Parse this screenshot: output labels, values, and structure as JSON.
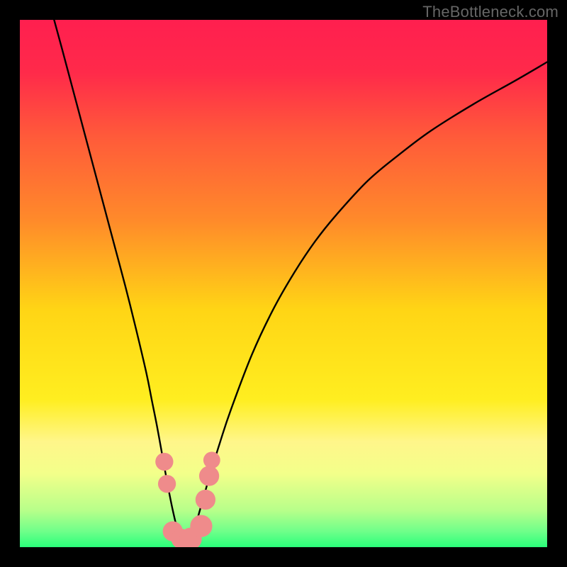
{
  "watermark": "TheBottleneck.com",
  "chart_data": {
    "type": "line",
    "title": "",
    "xlabel": "",
    "ylabel": "",
    "xlim": [
      0,
      100
    ],
    "ylim": [
      0,
      100
    ],
    "grid": false,
    "legend": false,
    "background_gradient": {
      "type": "vertical",
      "stops": [
        {
          "pos": 0.0,
          "color": "#ff1f4f"
        },
        {
          "pos": 0.1,
          "color": "#ff2a4a"
        },
        {
          "pos": 0.22,
          "color": "#ff5a3a"
        },
        {
          "pos": 0.38,
          "color": "#ff8a2a"
        },
        {
          "pos": 0.55,
          "color": "#ffd515"
        },
        {
          "pos": 0.72,
          "color": "#ffee20"
        },
        {
          "pos": 0.8,
          "color": "#fff68a"
        },
        {
          "pos": 0.86,
          "color": "#f3ff8a"
        },
        {
          "pos": 0.93,
          "color": "#b8ff8a"
        },
        {
          "pos": 0.97,
          "color": "#6fff8a"
        },
        {
          "pos": 1.0,
          "color": "#2aff7a"
        }
      ]
    },
    "series": [
      {
        "name": "bottleneck-curve",
        "color": "#000000",
        "approx_minimum_x": 31,
        "x": [
          6.5,
          8,
          10,
          12,
          14,
          16,
          18,
          20,
          22,
          24,
          25,
          26,
          27,
          28,
          29,
          30,
          31,
          32,
          33,
          34,
          35,
          36,
          38,
          40,
          44,
          48,
          52,
          56,
          60,
          66,
          72,
          78,
          86,
          94,
          100
        ],
        "y": [
          100,
          94.5,
          87,
          79.5,
          72,
          64.5,
          57,
          49.5,
          41.5,
          33,
          28,
          23,
          17.5,
          12,
          7,
          3,
          1,
          1,
          3,
          6.5,
          10,
          13.5,
          20,
          26,
          36.5,
          45,
          52,
          58,
          63,
          69.5,
          74.5,
          79,
          84,
          88.5,
          92
        ]
      }
    ],
    "markers": [
      {
        "name": "left-upper",
        "x": 27.4,
        "y": 16.2,
        "r": 1.7,
        "color": "#ef8b8b"
      },
      {
        "name": "left-mid",
        "x": 27.9,
        "y": 12.0,
        "r": 1.7,
        "color": "#ef8b8b"
      },
      {
        "name": "floor-1",
        "x": 29.0,
        "y": 3.0,
        "r": 1.9,
        "color": "#ef8b8b"
      },
      {
        "name": "floor-2",
        "x": 30.6,
        "y": 1.6,
        "r": 1.9,
        "color": "#ef8b8b"
      },
      {
        "name": "floor-3",
        "x": 32.4,
        "y": 1.6,
        "r": 2.1,
        "color": "#ef8b8b"
      },
      {
        "name": "floor-4",
        "x": 34.4,
        "y": 4.0,
        "r": 2.1,
        "color": "#ef8b8b"
      },
      {
        "name": "right-lower",
        "x": 35.2,
        "y": 9.0,
        "r": 1.9,
        "color": "#ef8b8b"
      },
      {
        "name": "right-upper",
        "x": 35.9,
        "y": 13.5,
        "r": 1.9,
        "color": "#ef8b8b"
      },
      {
        "name": "right-top",
        "x": 36.4,
        "y": 16.5,
        "r": 1.6,
        "color": "#ef8b8b"
      }
    ]
  }
}
